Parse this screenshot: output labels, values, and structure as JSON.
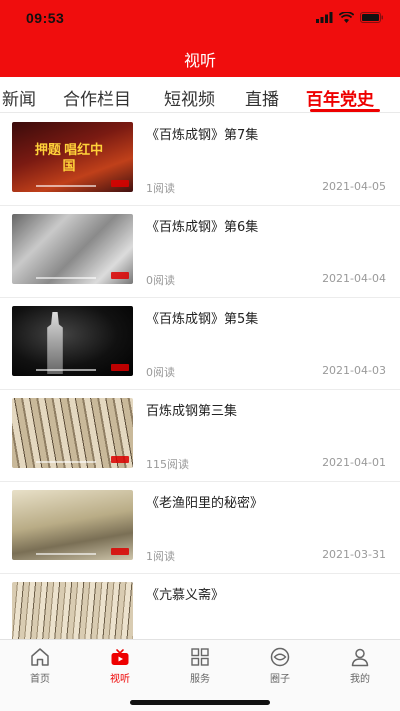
{
  "status_bar": {
    "time": "09:53"
  },
  "header": {
    "title": "视听"
  },
  "tabs": [
    {
      "label": "新闻"
    },
    {
      "label": "合作栏目"
    },
    {
      "label": "短视频"
    },
    {
      "label": "直播"
    },
    {
      "label": "百年党史",
      "active": true
    }
  ],
  "items": [
    {
      "title": "《百炼成钢》第7集",
      "reads": "1阅读",
      "date": "2021-04-05",
      "thumb_text": "押题 唱红中国"
    },
    {
      "title": "《百炼成钢》第6集",
      "reads": "0阅读",
      "date": "2021-04-04"
    },
    {
      "title": "《百炼成钢》第5集",
      "reads": "0阅读",
      "date": "2021-04-03"
    },
    {
      "title": "百炼成钢第三集",
      "reads": "115阅读",
      "date": "2021-04-01"
    },
    {
      "title": "《老渔阳里的秘密》",
      "reads": "1阅读",
      "date": "2021-03-31"
    },
    {
      "title": "《亢慕义斋》",
      "reads": "",
      "date": ""
    }
  ],
  "bottom_nav": [
    {
      "label": "首页",
      "icon": "home-icon"
    },
    {
      "label": "视听",
      "icon": "tv-icon",
      "active": true
    },
    {
      "label": "服务",
      "icon": "grid-icon"
    },
    {
      "label": "圈子",
      "icon": "circle-icon"
    },
    {
      "label": "我的",
      "icon": "person-icon"
    }
  ],
  "colors": {
    "brand": "#f00d0d",
    "active_text": "#e00000"
  }
}
